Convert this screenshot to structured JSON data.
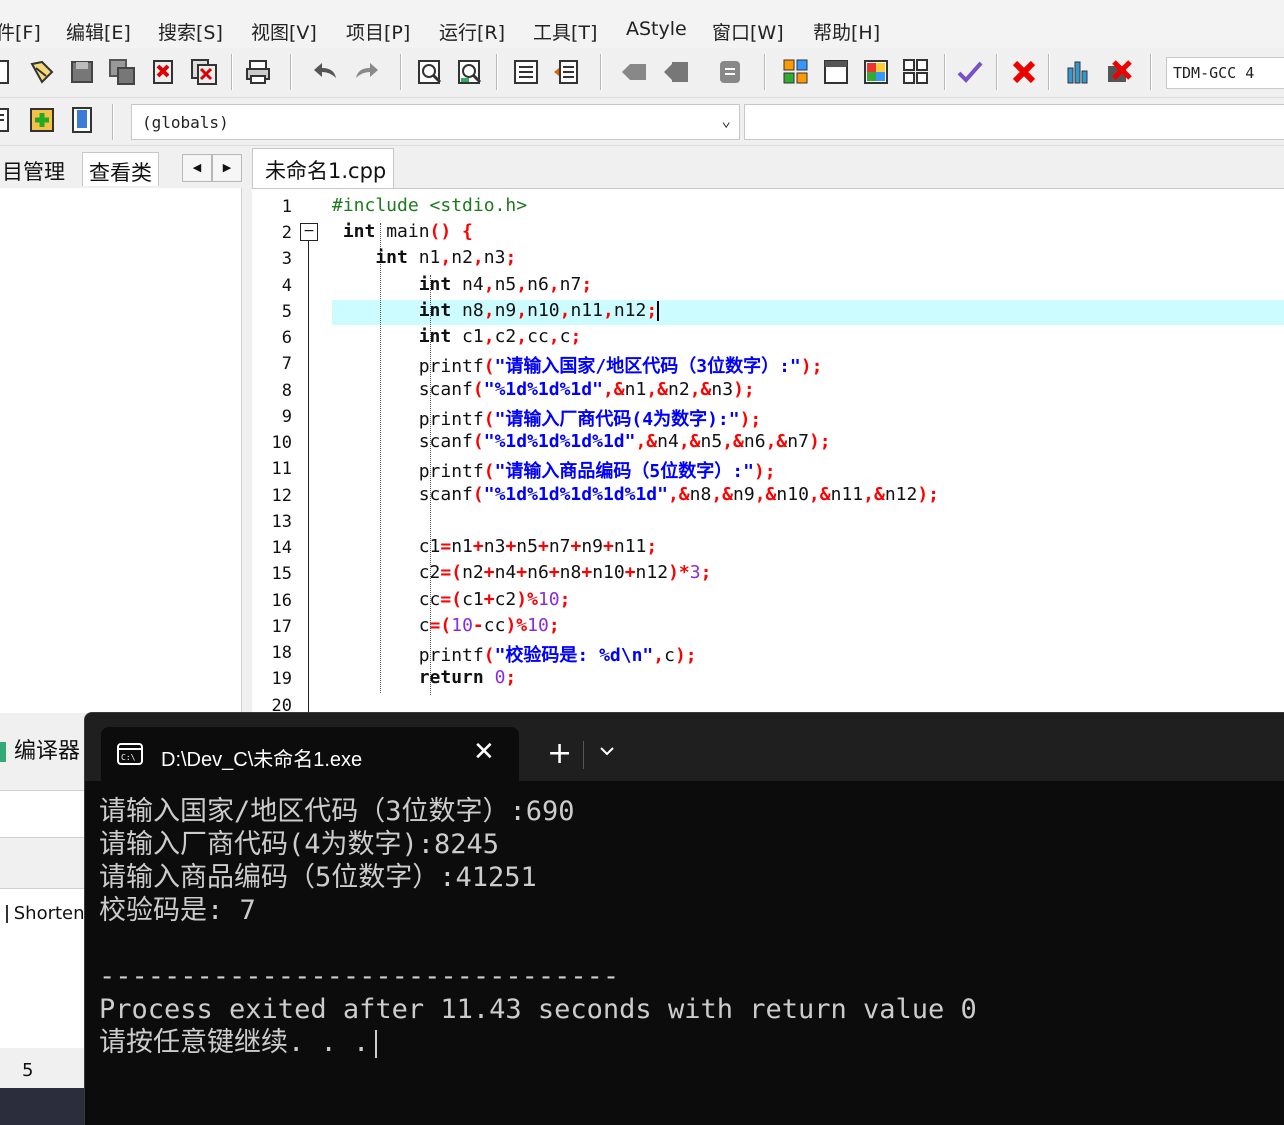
{
  "menu": {
    "items": [
      "件[F]",
      "编辑[E]",
      "搜索[S]",
      "视图[V]",
      "项目[P]",
      "运行[R]",
      "工具[T]",
      "AStyle",
      "窗口[W]",
      "帮助[H]"
    ]
  },
  "toolbar": {
    "compiler": "TDM-GCC 4",
    "icons": [
      "new-file-icon",
      "open-icon",
      "save-icon",
      "save-all-icon",
      "close-icon",
      "close-all-icon",
      "print-icon",
      "undo-icon",
      "redo-icon",
      "find-icon",
      "replace-icon",
      "indent-icon",
      "unindent-icon",
      "bookmark-prev-icon",
      "bookmark-next-icon",
      "comment-icon",
      "new-project-icon",
      "window-icon",
      "layout-icon",
      "grid-icon",
      "check-icon",
      "abort-icon",
      "chart-icon",
      "debug-icon"
    ]
  },
  "toolbar2": {
    "scope": "(globals)"
  },
  "tabs": {
    "project": "目管理",
    "classes": "查看类",
    "file": "未命名1.cpp"
  },
  "editor": {
    "line_numbers": [
      "1",
      "2",
      "3",
      "4",
      "5",
      "6",
      "7",
      "8",
      "9",
      "10",
      "11",
      "12",
      "13",
      "14",
      "15",
      "16",
      "17",
      "18",
      "19",
      "20"
    ],
    "highlighted_line": 5
  },
  "bottom_left": {
    "compiler_tab": "编译器",
    "shorten": "Shorten",
    "value": "5"
  },
  "terminal": {
    "title": "D:\\Dev_C\\未命名1.exe",
    "lines": [
      "请输入国家/地区代码（3位数字）:690",
      "请输入厂商代码(4为数字):8245",
      "请输入商品编码（5位数字）:41251",
      "校验码是: 7",
      "",
      "--------------------------------",
      "Process exited after 11.43 seconds with return value 0",
      "请按任意键继续. . ."
    ]
  }
}
